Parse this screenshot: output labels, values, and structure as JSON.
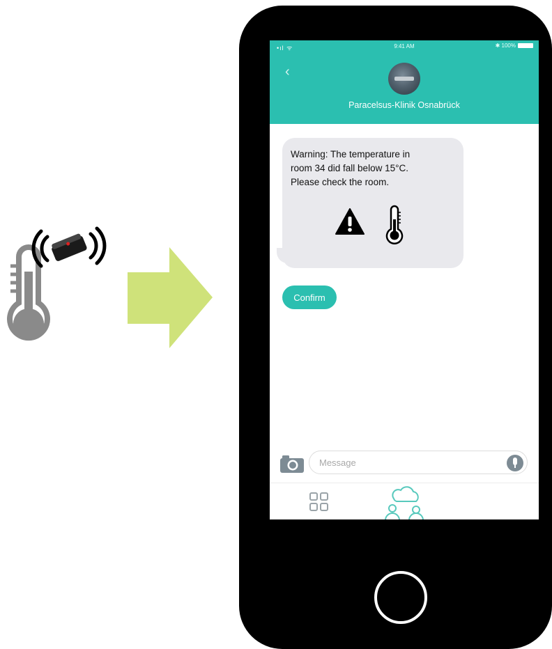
{
  "status_bar": {
    "signal": "•ıl ᯤ",
    "time": "9:41 AM",
    "battery": "✱ 100%"
  },
  "header": {
    "back": "‹",
    "contact_name": "Paracelsus-Klinik Osnabrück"
  },
  "message": {
    "lines": [
      "Warning: The temperature in",
      "room 34 did fall below 15°C.",
      "Please check the room."
    ],
    "icons": [
      "warning-triangle-icon",
      "thermometer-icon"
    ]
  },
  "confirm_button": {
    "label": "Confirm"
  },
  "composer": {
    "placeholder": "Message"
  },
  "tab_bar": {
    "items": [
      "apps-grid-icon",
      "community-icon"
    ]
  },
  "colors": {
    "accent": "#2bbfb0",
    "bubble": "#e9e9ed",
    "arrow": "#cfe27a",
    "phone": "#000000"
  }
}
